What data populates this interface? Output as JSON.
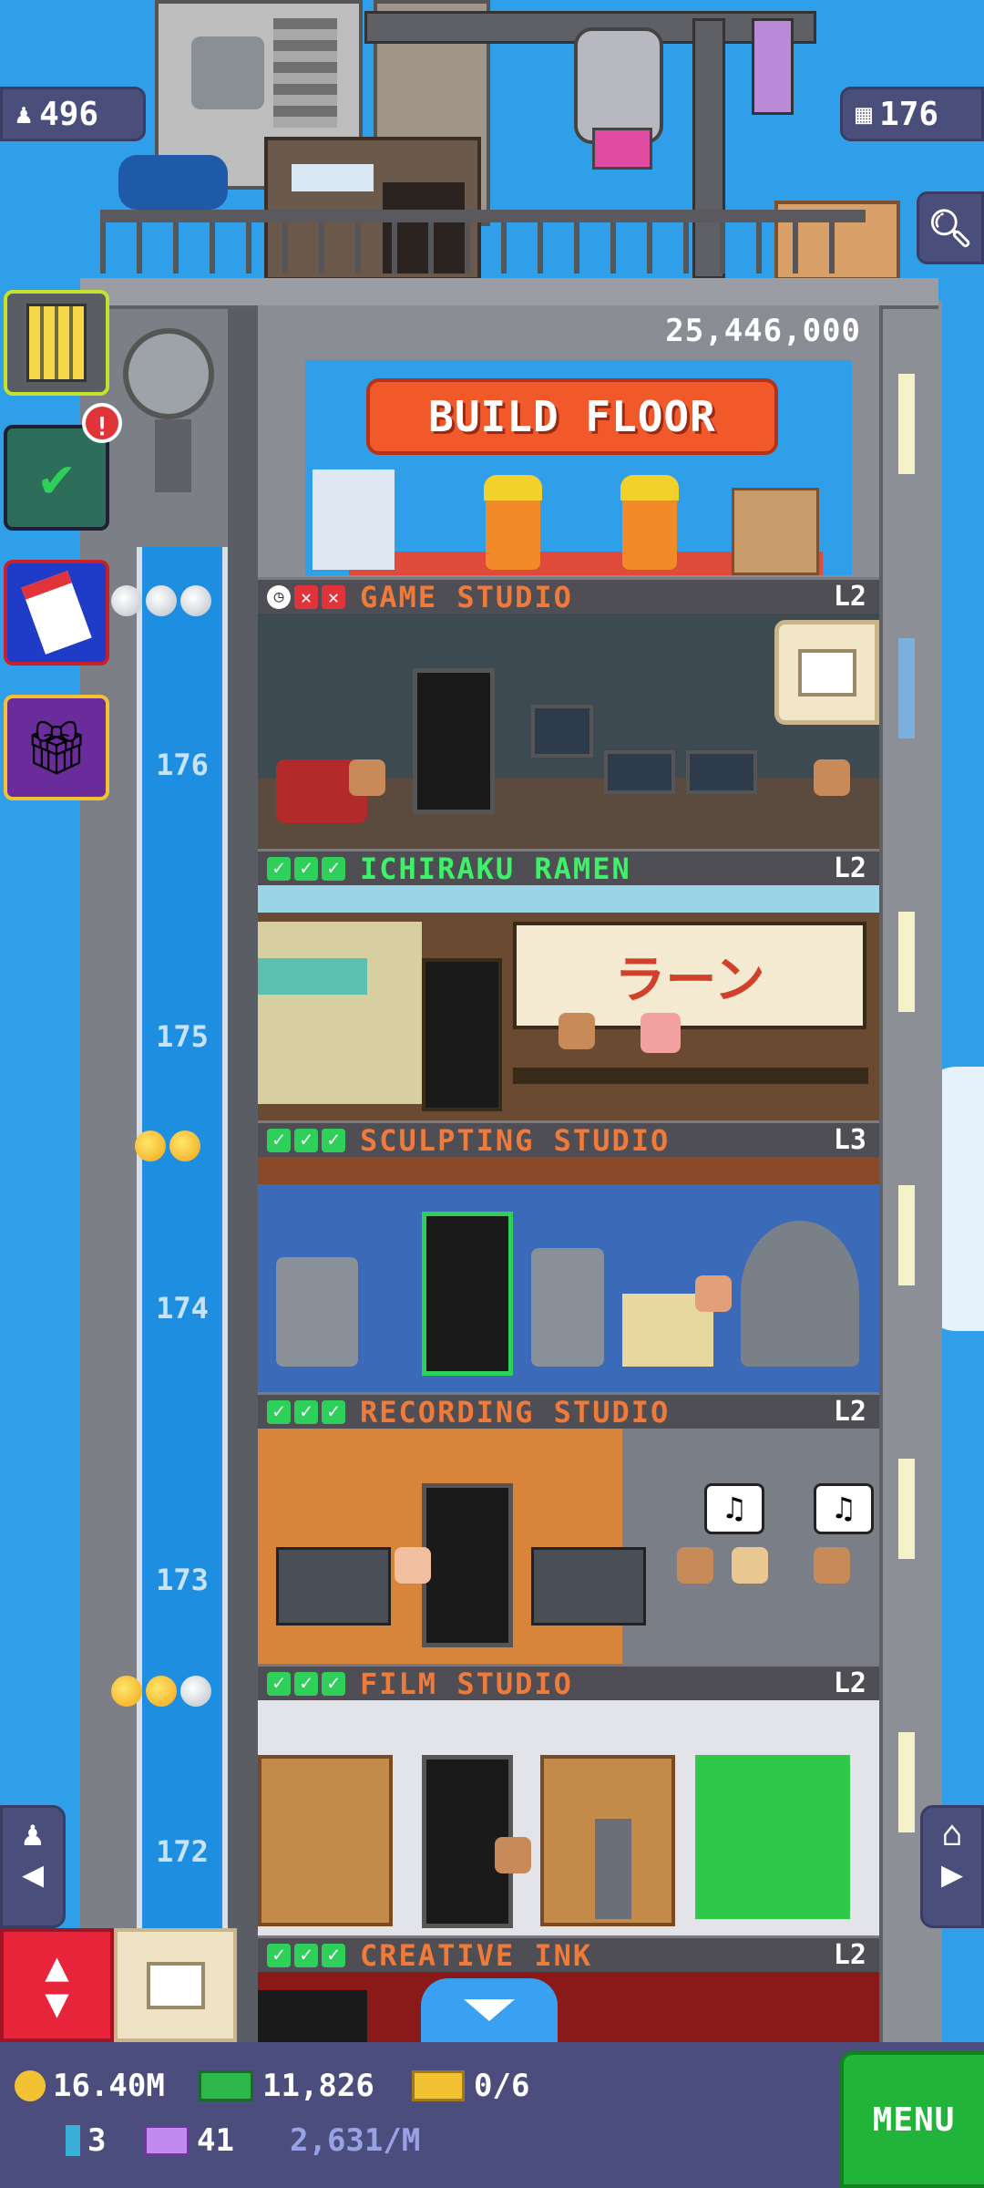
{
  "hud": {
    "population": "496",
    "floors": "176",
    "coins_to_build": "25,446,000",
    "build_floor_label": "BUILD FLOOR"
  },
  "elevator": {
    "floor_numbers": [
      "176",
      "175",
      "174",
      "173",
      "172"
    ]
  },
  "floors": [
    {
      "name": "GAME STUDIO",
      "level": "L2",
      "status": [
        "clock",
        "cross",
        "cross"
      ]
    },
    {
      "name": "ICHIRAKU RAMEN",
      "level": "L2",
      "status": [
        "check",
        "check",
        "check"
      ]
    },
    {
      "name": "SCULPTING STUDIO",
      "level": "L3",
      "status": [
        "check",
        "check",
        "check"
      ]
    },
    {
      "name": "RECORDING STUDIO",
      "level": "L2",
      "status": [
        "check",
        "check",
        "check"
      ]
    },
    {
      "name": "FILM STUDIO",
      "level": "L2",
      "status": [
        "check",
        "check",
        "check"
      ]
    },
    {
      "name": "CREATIVE INK",
      "level": "L2",
      "status": [
        "check",
        "check",
        "check"
      ]
    }
  ],
  "ramen_sign": "ラーン",
  "bottom_bar": {
    "coins": "16.40M",
    "bux": "11,826",
    "tickets": "0/6",
    "keys": "3",
    "vip": "41",
    "rate": "2,631/M",
    "menu_label": "MENU"
  },
  "colors": {
    "sky": "#2f9fea",
    "accent_orange": "#f07a3a",
    "menu_green": "#22b43a",
    "build_button": "#f2592a"
  }
}
